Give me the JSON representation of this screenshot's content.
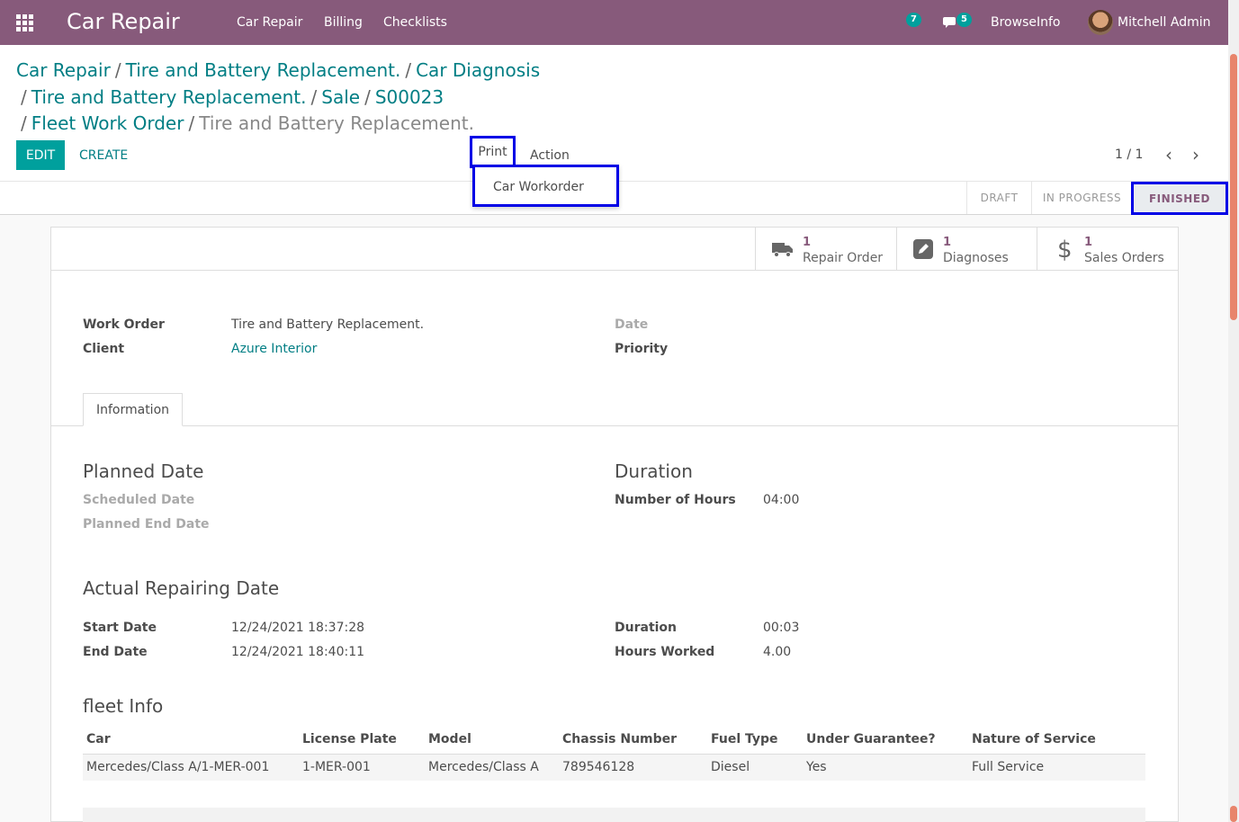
{
  "navbar": {
    "app_title": "Car Repair",
    "menu": [
      "Car Repair",
      "Billing",
      "Checklists"
    ],
    "activity_count": "7",
    "message_count": "5",
    "company": "BrowseInfo",
    "user": "Mitchell Admin"
  },
  "breadcrumb": {
    "items": [
      "Car Repair",
      "Tire and Battery Replacement.",
      "Car Diagnosis",
      "Tire and Battery Replacement.",
      "Sale",
      "S00023",
      "Fleet Work Order"
    ],
    "current": "Tire and Battery Replacement.",
    "separator": "/"
  },
  "controls": {
    "edit": "EDIT",
    "create": "CREATE",
    "print": "Print",
    "action": "Action",
    "print_menu_item": "Car Workorder",
    "pager": "1 / 1"
  },
  "status": {
    "stages": [
      "DRAFT",
      "IN PROGRESS",
      "FINISHED"
    ],
    "active": "FINISHED"
  },
  "smart_buttons": [
    {
      "count": "1",
      "label": "Repair Order",
      "icon": "truck-icon"
    },
    {
      "count": "1",
      "label": "Diagnoses",
      "icon": "pencil-square-icon"
    },
    {
      "count": "1",
      "label": "Sales Orders",
      "icon": "dollar-icon"
    }
  ],
  "form": {
    "work_order_label": "Work Order",
    "work_order": "Tire and Battery Replacement.",
    "client_label": "Client",
    "client": "Azure Interior",
    "date_label": "Date",
    "priority_label": "Priority",
    "tab": "Information",
    "planned_title": "Planned Date",
    "scheduled_label": "Scheduled Date",
    "planned_end_label": "Planned End Date",
    "duration_title": "Duration",
    "hours_label": "Number of Hours",
    "hours": "04:00",
    "actual_title": "Actual Repairing Date",
    "start_label": "Start Date",
    "start": "12/24/2021 18:37:28",
    "end_label": "End Date",
    "end": "12/24/2021 18:40:11",
    "duration_label": "Duration",
    "duration": "00:03",
    "worked_label": "Hours Worked",
    "worked": "4.00",
    "fleet_title": "fleet Info"
  },
  "fleet_table": {
    "headers": [
      "Car",
      "License Plate",
      "Model",
      "Chassis Number",
      "Fuel Type",
      "Under Guarantee?",
      "Nature of Service"
    ],
    "rows": [
      [
        "Mercedes/Class A/1-MER-001",
        "1-MER-001",
        "Mercedes/Class A",
        "789546128",
        "Diesel",
        "Yes",
        "Full Service"
      ]
    ]
  }
}
